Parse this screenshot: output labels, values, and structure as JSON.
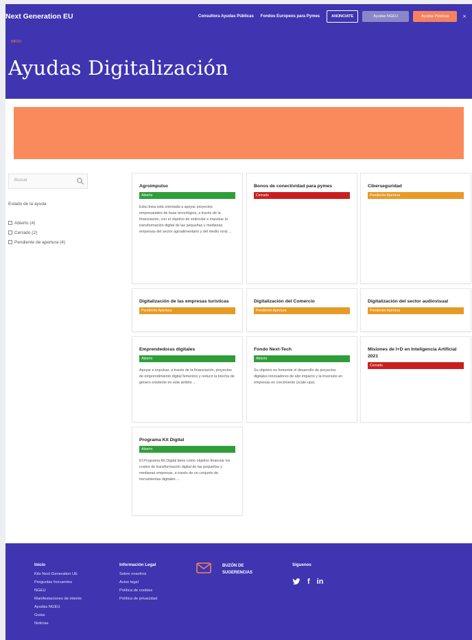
{
  "header": {
    "brand": "Next Generation EU",
    "nav": {
      "link1": "Consultora Ayudas Públicas",
      "link2": "Fondos Europeos para Pymes",
      "btn_subscribe": "ANÚNCIATE",
      "btn_grey": "Ayudas NGEU",
      "btn_coral": "Ayudas Públicas",
      "close": "×"
    },
    "breadcrumb": "INICIO",
    "page_title": "Ayudas Digitalización",
    "banner_color": "#fa8a5c"
  },
  "sidebar": {
    "search_placeholder": "Buscar",
    "filter_title": "Estado de la ayuda",
    "filters": [
      {
        "label": "Abierto (4)"
      },
      {
        "label": "Cerrado (2)"
      },
      {
        "label": "Pendiente de apertura (4)"
      }
    ]
  },
  "cards": [
    {
      "title": "Agroimpulso",
      "status": "Abierto",
      "desc": "Esta línea está orientada a apoyar proyectos empresariales de base tecnológica, a través de la financiación, con el objetivo de estimular e impulsar la transformación digital de las pequeñas y medianas empresas del sector agroalimentario y del medio rural ..."
    },
    {
      "title": "Bonos de conectividad para pymes",
      "status": "Cerrado",
      "desc": ""
    },
    {
      "title": "Ciberseguridad",
      "status": "Pendiente Apertura",
      "desc": ""
    },
    {
      "title": "Digitalización de las empresas turísticas",
      "status": "Pendiente Apertura",
      "desc": ""
    },
    {
      "title": "Digitalización del Comercio",
      "status": "Pendiente Apertura",
      "desc": ""
    },
    {
      "title": "Digitalización del sector audiovisual",
      "status": "Pendiente Apertura",
      "desc": ""
    },
    {
      "title": "Emprendedoras digitales",
      "status": "Abierto",
      "desc": "Apoyar e impulsar, a través de la financiación, proyectos de emprendimiento digital femenino y reducir la brecha de género existente en este ámbito ..."
    },
    {
      "title": "Fondo Next-Tech",
      "status": "Abierto",
      "desc": "Su objetivo es fomentar el desarrollo de proyectos digitales innovadores de alto impacto y la inversión en empresas en crecimiento (scale-ups)."
    },
    {
      "title": "Misiones de I+D en Inteligencia Artificial 2021",
      "status": "Cerrado",
      "desc": ""
    },
    {
      "title": "Programa Kit Digital",
      "status": "Abierto",
      "desc": "El Programa Kit Digital tiene como objetivo financiar los costes de transformación digital de las pequeñas y medianas empresas, a través de un conjunto de herramientas digitales ..."
    }
  ],
  "footer": {
    "col1_title": "Inicio",
    "col1_links": [
      "Kits Next Generation UE",
      "Preguntas frecuentes",
      "NGEU",
      "Manifestaciones de interés",
      "Ayudas NGEU",
      "Guías",
      "Noticias"
    ],
    "col2_title": "Información Legal",
    "col2_links": [
      "Sobre nosotros",
      "Aviso legal",
      "Política de cookies",
      "Política de privacidad"
    ],
    "mail_line1": "BUZÓN DE",
    "mail_line2": "SUGERENCIAS",
    "follow_title": "Síguenos",
    "social_twitter": "🐦",
    "social_facebook": "f",
    "social_linkedin": "in"
  },
  "colors": {
    "brand": "#3f35b0",
    "accent": "#fa8a5c",
    "abierto": "#2f9e3a",
    "cerrado": "#c9201f",
    "pendiente": "#e79a26"
  }
}
